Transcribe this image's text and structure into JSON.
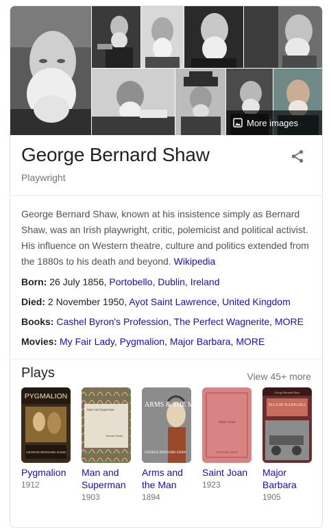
{
  "gallery": {
    "more_images_label": "More images",
    "photos": [
      "portrait-main",
      "photo-2",
      "photo-3",
      "photo-4",
      "photo-5",
      "photo-6",
      "photo-7",
      "photo-8",
      "photo-9"
    ]
  },
  "entity": {
    "name": "George Bernard Shaw",
    "type": "Playwright",
    "share_icon": "share-icon"
  },
  "description": {
    "text": "George Bernard Shaw, known at his insistence simply as Bernard Shaw, was an Irish playwright, critic, polemicist and political activist. His influence on Western theatre, culture and politics extended from the 1880s to his death and beyond.",
    "source_link": "Wikipedia"
  },
  "facts": {
    "born": {
      "label": "Born:",
      "text": "26 July 1856,",
      "link": "Portobello, Dublin, Ireland"
    },
    "died": {
      "label": "Died:",
      "text": "2 November 1950,",
      "link": "Ayot Saint Lawrence, United Kingdom"
    },
    "books": {
      "label": "Books:",
      "links": [
        "Cashel Byron's Profession",
        "The Perfect Wagnerite",
        "MORE"
      ]
    },
    "movies": {
      "label": "Movies:",
      "links": [
        "My Fair Lady",
        "Pygmalion",
        "Major Barbara",
        "MORE"
      ]
    }
  },
  "plays": {
    "heading": "Plays",
    "view_more": "View 45+ more",
    "items": [
      {
        "title": "Pygmalion",
        "year": "1912"
      },
      {
        "title": "Man and Superman",
        "year": "1903"
      },
      {
        "title": "Arms and the Man",
        "year": "1894"
      },
      {
        "title": "Saint Joan",
        "year": "1923"
      },
      {
        "title": "Major Barbara",
        "year": "1905"
      }
    ],
    "cover_text": {
      "pygmalion": "PYGMALION",
      "pygmalion_author": "GEORGE BERNARD SHAW",
      "superman": "Man And Superman",
      "superman_author": "Bernard Shaw",
      "arms": "ARMS & THE MAN",
      "arms_author": "GEORGE BERNARD SHAW",
      "joan": "Saint Joan",
      "joan_author": "BERNARD SHAW",
      "barbara_author": "George Bernard Shaw",
      "barbara": "MAJOR BARBARA"
    }
  },
  "colors": {
    "link": "#1a0dab",
    "muted": "#70757a",
    "text": "#202124",
    "border": "#dfe1e5"
  }
}
